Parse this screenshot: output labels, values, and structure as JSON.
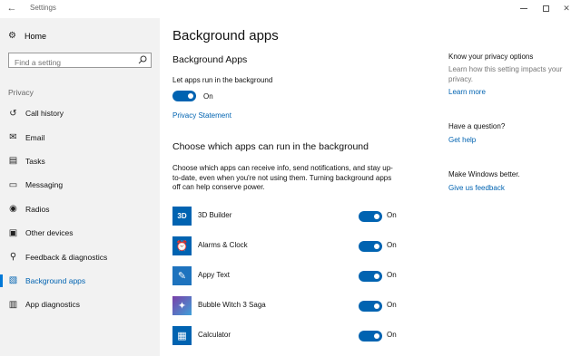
{
  "window": {
    "title": "Settings"
  },
  "sidebar": {
    "home_label": "Home",
    "search_placeholder": "Find a setting",
    "section_label": "Privacy",
    "items": [
      {
        "label": "Call history",
        "icon": "call-history-icon",
        "glyph": "↺"
      },
      {
        "label": "Email",
        "icon": "email-icon",
        "glyph": "✉"
      },
      {
        "label": "Tasks",
        "icon": "tasks-icon",
        "glyph": "▤"
      },
      {
        "label": "Messaging",
        "icon": "messaging-icon",
        "glyph": "▭"
      },
      {
        "label": "Radios",
        "icon": "radios-icon",
        "glyph": "◉"
      },
      {
        "label": "Other devices",
        "icon": "other-devices-icon",
        "glyph": "▣"
      },
      {
        "label": "Feedback & diagnostics",
        "icon": "feedback-icon",
        "glyph": "⚲"
      },
      {
        "label": "Background apps",
        "icon": "background-apps-icon",
        "glyph": "▧",
        "active": true
      },
      {
        "label": "App diagnostics",
        "icon": "app-diagnostics-icon",
        "glyph": "▥"
      }
    ]
  },
  "main": {
    "title": "Background apps",
    "section1_title": "Background Apps",
    "let_apps_label": "Let apps run in the background",
    "let_apps_state": "On",
    "privacy_link": "Privacy Statement",
    "section2_title": "Choose which apps can run in the background",
    "description": "Choose which apps can receive info, send notifications, and stay up-to-date, even when you're not using them. Turning background apps off can help conserve power.",
    "apps": [
      {
        "name": "3D Builder",
        "state": "On",
        "icon": "3d-builder-icon",
        "color": "#0063b1",
        "glyph": "3D"
      },
      {
        "name": "Alarms & Clock",
        "state": "On",
        "icon": "alarms-clock-icon",
        "color": "#0063b1",
        "glyph": "⏰"
      },
      {
        "name": "Appy Text",
        "state": "On",
        "icon": "appy-text-icon",
        "color": "#1e73be",
        "glyph": "✎"
      },
      {
        "name": "Bubble Witch 3 Saga",
        "state": "On",
        "icon": "bubble-witch-icon",
        "color": "#7a3fa8",
        "glyph": "✦"
      },
      {
        "name": "Calculator",
        "state": "On",
        "icon": "calculator-icon",
        "color": "#0063b1",
        "glyph": "▦"
      }
    ]
  },
  "right": {
    "privacy_title": "Know your privacy options",
    "privacy_text": "Learn how this setting impacts your privacy.",
    "learn_more": "Learn more",
    "question_title": "Have a question?",
    "get_help": "Get help",
    "better_title": "Make Windows better.",
    "feedback_link": "Give us feedback"
  },
  "colors": {
    "accent": "#0063b1",
    "sidebar_bg": "#f2f2f2"
  }
}
